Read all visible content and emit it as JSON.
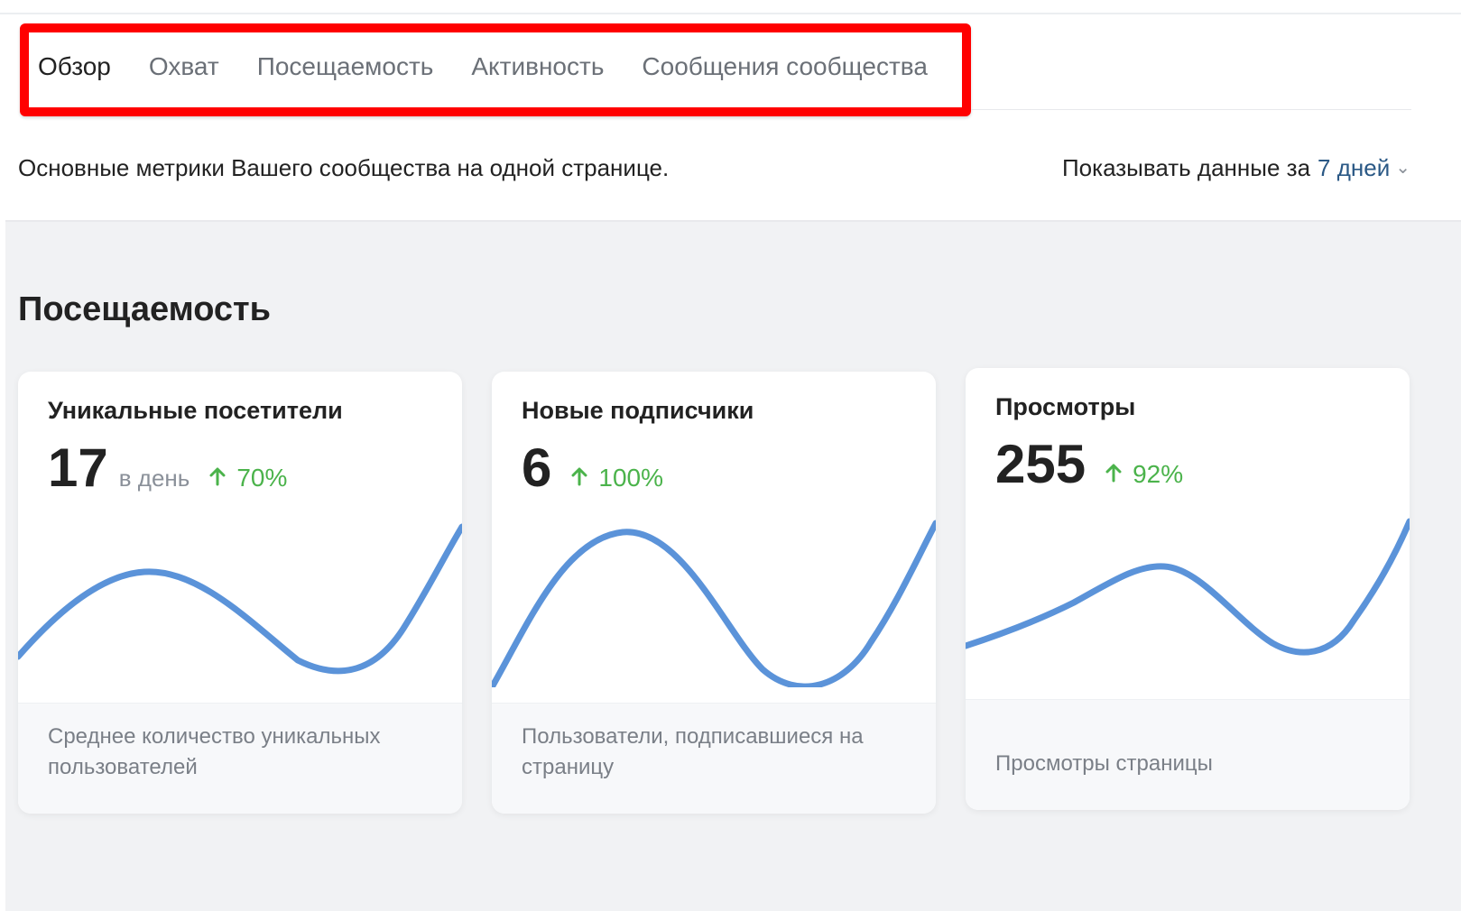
{
  "tabs": [
    "Обзор",
    "Охват",
    "Посещаемость",
    "Активность",
    "Сообщения сообщества"
  ],
  "subtitle": "Основные метрики Вашего сообщества на одной странице.",
  "period": {
    "label": "Показывать данные за",
    "value": "7 дней"
  },
  "section_title": "Посещаемость",
  "cards": [
    {
      "title": "Уникальные посетители",
      "value": "17",
      "unit": "в день",
      "delta": "70%",
      "description": "Среднее количество уникальных пользователей"
    },
    {
      "title": "Новые подписчики",
      "value": "6",
      "unit": "",
      "delta": "100%",
      "description": "Пользователи, подписавшиеся на страницу"
    },
    {
      "title": "Просмотры",
      "value": "255",
      "unit": "",
      "delta": "92%",
      "description": "Просмотры страницы"
    }
  ],
  "colors": {
    "accent": "#2a5885",
    "positive": "#4bb34b",
    "line": "#5b93d9",
    "highlight": "#ff0000"
  }
}
